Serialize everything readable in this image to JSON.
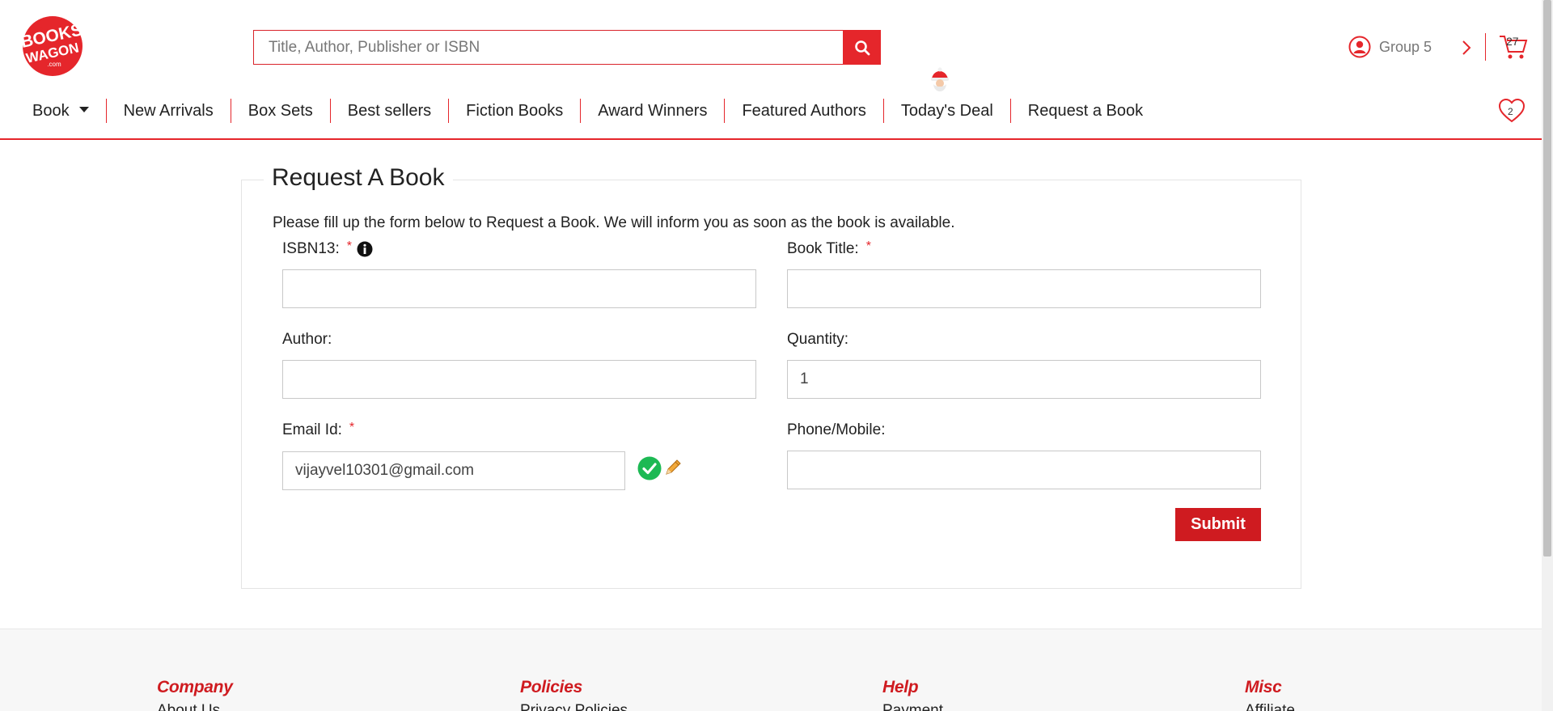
{
  "header": {
    "logo_text": "BOOKSWAGON.com",
    "search_placeholder": "Title, Author, Publisher or ISBN",
    "account_label": "Group 5",
    "cart_count": "27",
    "wishlist_count": "2"
  },
  "nav": {
    "items": [
      {
        "label": "Book"
      },
      {
        "label": "New Arrivals"
      },
      {
        "label": "Box Sets"
      },
      {
        "label": "Best sellers"
      },
      {
        "label": "Fiction Books"
      },
      {
        "label": "Award Winners"
      },
      {
        "label": "Featured Authors"
      },
      {
        "label": "Today's Deal"
      },
      {
        "label": "Request a Book"
      }
    ]
  },
  "form": {
    "title": "Request A Book",
    "intro": "Please fill up the form below to Request a Book. We will inform you as soon as the book is available.",
    "isbn_label": "ISBN13:",
    "isbn_value": "",
    "book_title_label": "Book Title:",
    "book_title_value": "",
    "author_label": "Author:",
    "author_value": "",
    "quantity_label": "Quantity:",
    "quantity_value": "1",
    "email_label": "Email Id:",
    "email_value": "vijayvel10301@gmail.com",
    "phone_label": "Phone/Mobile:",
    "phone_value": "",
    "required_mark": "*",
    "submit_label": "Submit"
  },
  "footer": {
    "columns": [
      {
        "heading": "Company",
        "first_link": "About Us"
      },
      {
        "heading": "Policies",
        "first_link": "Privacy Policies"
      },
      {
        "heading": "Help",
        "first_link": "Payment"
      },
      {
        "heading": "Misc",
        "first_link": "Affiliate"
      }
    ]
  },
  "colors": {
    "brand_red": "#e5262b",
    "submit_red": "#cf1b20",
    "verified_green": "#1db954"
  },
  "icons": [
    "search-icon",
    "user-icon",
    "chevron-right-icon",
    "cart-icon",
    "heart-icon",
    "info-icon",
    "check-circle-icon",
    "pencil-icon",
    "santa-icon"
  ]
}
